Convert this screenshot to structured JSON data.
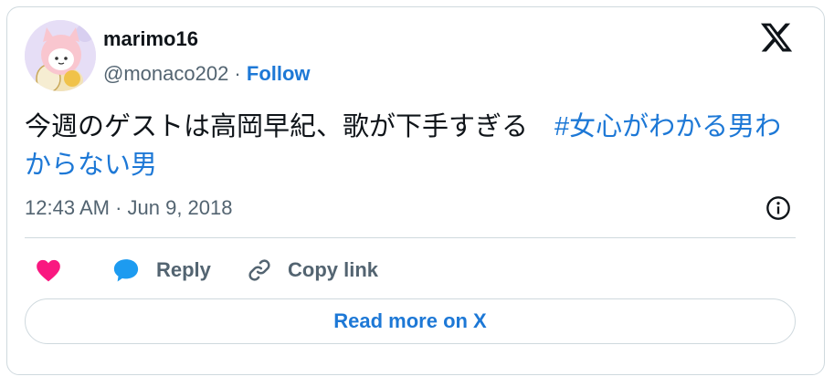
{
  "author": {
    "name": "marimo16",
    "handle": "@monaco202",
    "separator": " · ",
    "follow_label": "Follow",
    "avatar_icon": "cat-hood-avatar"
  },
  "tweet": {
    "text": "今週のゲストは高岡早紀、歌が下手すぎる　",
    "hashtag": "#女心がわかる男わからない男"
  },
  "timestamp": "12:43 AM · Jun 9, 2018",
  "actions": {
    "like_icon": "heart-icon",
    "reply_label": "Reply",
    "copy_link_label": "Copy link"
  },
  "read_more_label": "Read more on X",
  "colors": {
    "accent": "#1d78d6",
    "like": "#f91880",
    "muted": "#536471",
    "text": "#0f1419"
  }
}
